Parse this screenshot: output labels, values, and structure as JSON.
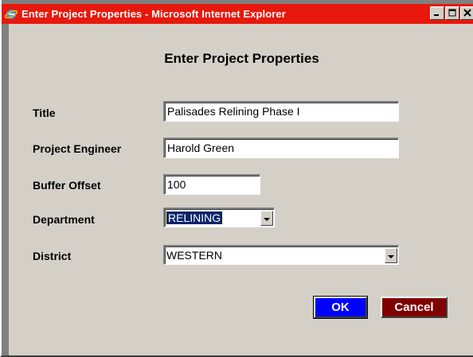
{
  "window": {
    "title": "Enter Project Properties - Microsoft Internet Explorer"
  },
  "dialog": {
    "heading": "Enter Project Properties",
    "fields": {
      "title": {
        "label": "Title",
        "value": "Palisades Relining Phase I"
      },
      "engineer": {
        "label": "Project Engineer",
        "value": "Harold Green"
      },
      "buffer": {
        "label": "Buffer Offset",
        "value": "100"
      },
      "department": {
        "label": "Department",
        "value": "RELINING"
      },
      "district": {
        "label": "District",
        "value": "WESTERN"
      }
    },
    "buttons": {
      "ok": "OK",
      "cancel": "Cancel"
    }
  },
  "colors": {
    "titlebar": "#e8180c",
    "ok_button": "#0000ff",
    "cancel_button": "#800000",
    "dialog_bg": "#d4d0c8"
  },
  "icons": {
    "app": "internet-explorer-icon",
    "minimize": "minimize-icon",
    "maximize": "maximize-icon",
    "close": "close-icon",
    "dropdown": "chevron-down-icon"
  }
}
